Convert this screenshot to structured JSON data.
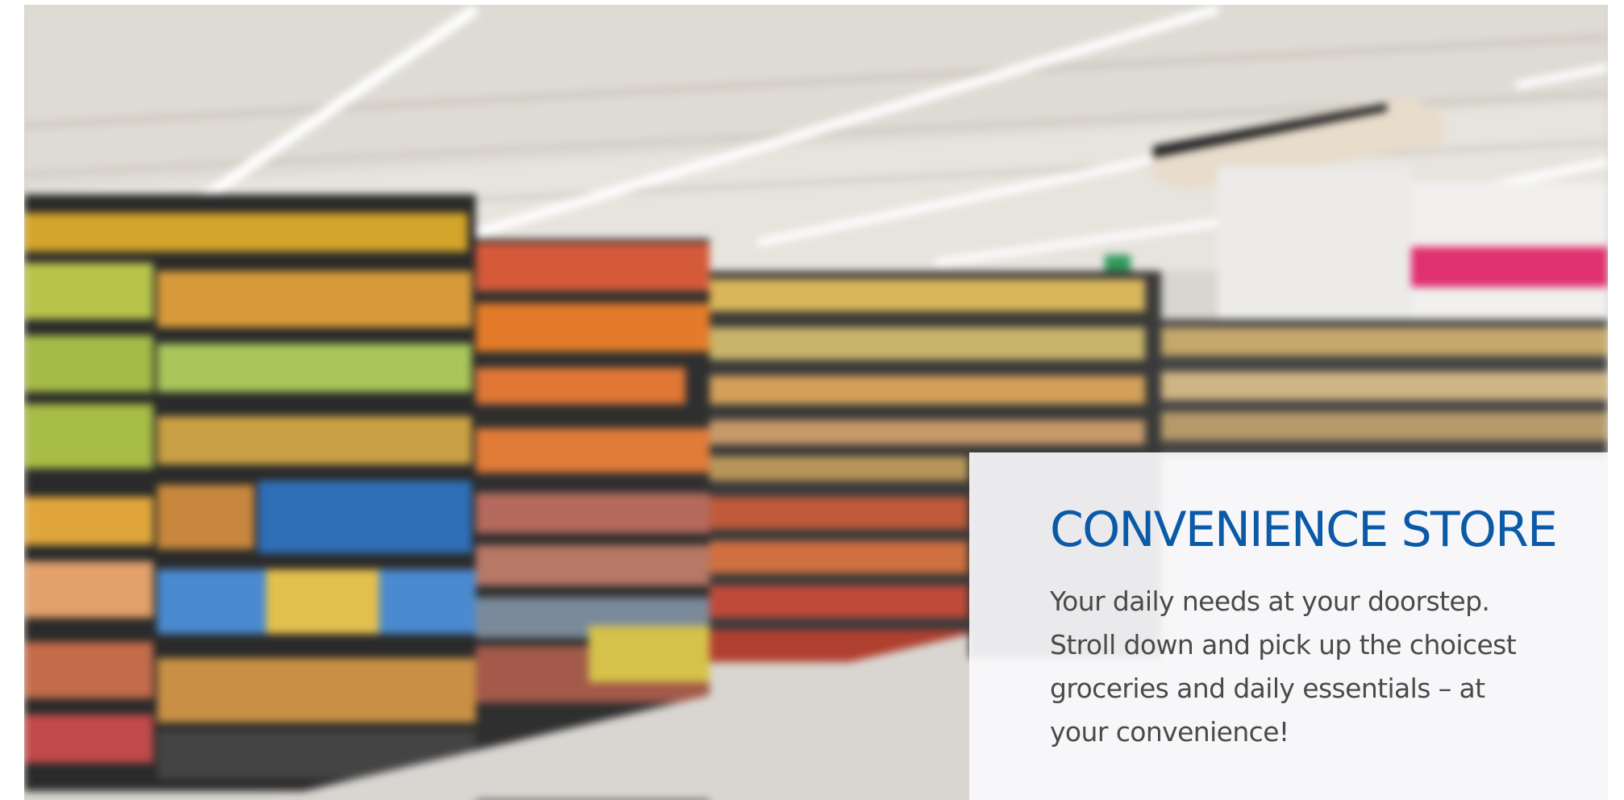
{
  "hero": {
    "image_description": "",
    "theme_colors": {
      "title": "#0a5aa8",
      "body_text": "#4a4a4a",
      "card_background": "#fafafc",
      "accent_wall_stripe": "#e0306f"
    }
  },
  "card": {
    "title": "CONVENIENCE STORE",
    "description": "Your daily needs at your doorstep. Stroll down and pick up the choicest groceries and daily essentials – at your convenience!"
  }
}
